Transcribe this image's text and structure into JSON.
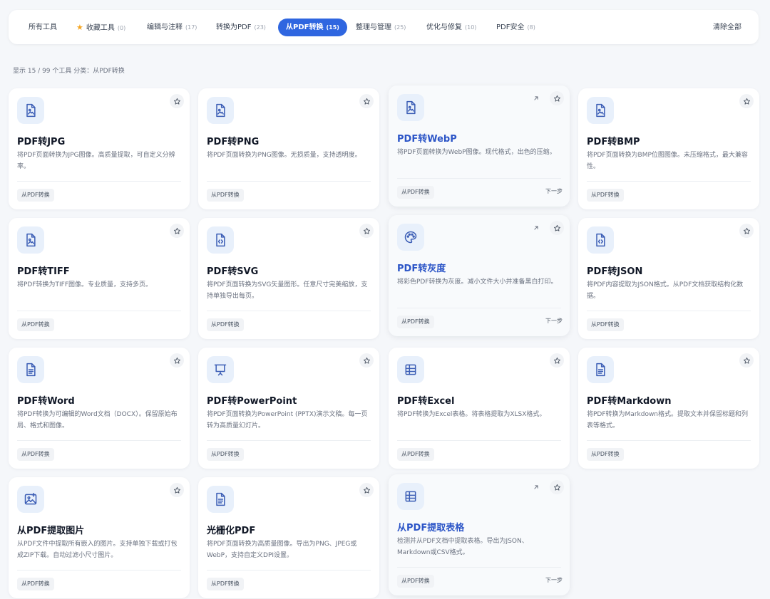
{
  "colors": {
    "accent": "#2f66e0",
    "icon_bg": "#e8f0fb",
    "icon_stroke": "#3b5db5",
    "star": "#f5a623"
  },
  "filter_tabs": [
    {
      "label": "所有工具",
      "count": "",
      "active": false
    },
    {
      "label": "收藏工具",
      "count": "(0)",
      "active": false,
      "icon": "star-icon"
    },
    {
      "label": "编辑与注释",
      "count": "(17)",
      "active": false
    },
    {
      "label": "转换为PDF",
      "count": "(23)",
      "active": false
    },
    {
      "label": "从PDF转换",
      "count": "(15)",
      "active": true
    },
    {
      "label": "整理与管理",
      "count": "(25)",
      "active": false
    },
    {
      "label": "优化与修复",
      "count": "(10)",
      "active": false
    },
    {
      "label": "PDF安全",
      "count": "(8)",
      "active": false
    }
  ],
  "clear_all_label": "清除全部",
  "summary": "显示 15 / 99 个工具 分类：从PDF转换",
  "tools": [
    {
      "title": "PDF转JPG",
      "desc": "将PDF页面转换为JPG图像。高质量提取，可自定义分辨率。",
      "badge": "从PDF转换",
      "icon": "file-image-icon"
    },
    {
      "title": "PDF转PNG",
      "desc": "将PDF页面转换为PNG图像。无损质量，支持透明度。",
      "badge": "从PDF转换",
      "icon": "file-image-icon"
    },
    {
      "title": "PDF转WebP",
      "desc": "将PDF页面转换为WebP图像。现代格式，出色的压缩。",
      "badge": "从PDF转换",
      "icon": "file-image-icon",
      "highlight": true,
      "next": "下一步"
    },
    {
      "title": "PDF转BMP",
      "desc": "将PDF页面转换为BMP位图图像。未压缩格式，最大兼容性。",
      "badge": "从PDF转换",
      "icon": "file-image-icon"
    },
    {
      "title": "PDF转TIFF",
      "desc": "将PDF转换为TIFF图像。专业质量，支持多页。",
      "badge": "从PDF转换",
      "icon": "file-image-icon"
    },
    {
      "title": "PDF转SVG",
      "desc": "将PDF页面转换为SVG矢量图形。任意尺寸完美缩放，支持单独导出每页。",
      "badge": "从PDF转换",
      "icon": "file-code-icon"
    },
    {
      "title": "PDF转灰度",
      "desc": "将彩色PDF转换为灰度。减小文件大小并准备黑白打印。",
      "badge": "从PDF转换",
      "icon": "palette-icon",
      "highlight": true,
      "next": "下一步"
    },
    {
      "title": "PDF转JSON",
      "desc": "将PDF内容提取为JSON格式。从PDF文档获取结构化数据。",
      "badge": "从PDF转换",
      "icon": "file-code-icon"
    },
    {
      "title": "PDF转Word",
      "desc": "将PDF转换为可编辑的Word文档（DOCX）。保留原始布局、格式和图像。",
      "badge": "从PDF转换",
      "icon": "file-text-icon"
    },
    {
      "title": "PDF转PowerPoint",
      "desc": "将PDF页面转换为PowerPoint (PPTX)演示文稿。每一页转为高质量幻灯片。",
      "badge": "从PDF转换",
      "icon": "presentation-icon"
    },
    {
      "title": "PDF转Excel",
      "desc": "将PDF转换为Excel表格。将表格提取为XLSX格式。",
      "badge": "从PDF转换",
      "icon": "table-icon"
    },
    {
      "title": "PDF转Markdown",
      "desc": "将PDF转换为Markdown格式。提取文本并保留标题和列表等格式。",
      "badge": "从PDF转换",
      "icon": "file-text-icon"
    },
    {
      "title": "从PDF提取图片",
      "desc": "从PDF文件中提取所有嵌入的图片。支持单独下载或打包成ZIP下载。自动过滤小尺寸图片。",
      "badge": "从PDF转换",
      "icon": "image-icon"
    },
    {
      "title": "光栅化PDF",
      "desc": "将PDF页面转换为高质量图像。导出为PNG、JPEG或WebP，支持自定义DPI设置。",
      "badge": "从PDF转换",
      "icon": "file-text-icon"
    },
    {
      "title": "从PDF提取表格",
      "desc": "检测并从PDF文档中提取表格。导出为JSON、Markdown或CSV格式。",
      "badge": "从PDF转换",
      "icon": "table-icon",
      "highlight": true,
      "next": "下一步"
    }
  ]
}
